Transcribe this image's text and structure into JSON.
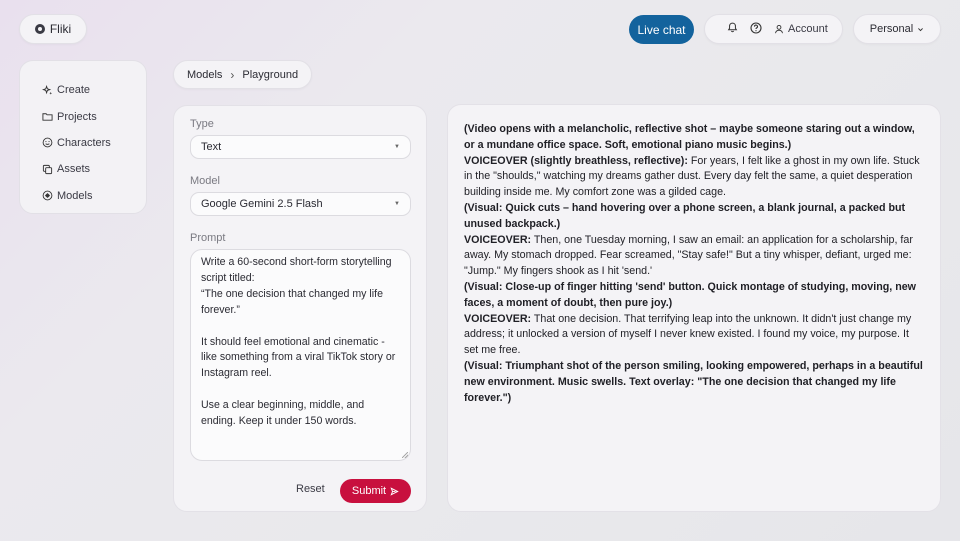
{
  "brand": {
    "name": "Fliki",
    "icon": "fliki-logo-icon"
  },
  "header": {
    "live_chat": "Live chat",
    "account": "Account",
    "workspace": "Personal",
    "icons": [
      "bell-icon",
      "help-icon",
      "user-icon",
      "chevron-down-icon"
    ]
  },
  "sidebar": {
    "items": [
      {
        "label": "Create",
        "icon": "sparkle-icon"
      },
      {
        "label": "Projects",
        "icon": "folder-icon"
      },
      {
        "label": "Characters",
        "icon": "smiley-icon"
      },
      {
        "label": "Assets",
        "icon": "copy-icon"
      },
      {
        "label": "Models",
        "icon": "grid-icon"
      }
    ]
  },
  "breadcrumb": {
    "root": "Models",
    "separator": "›",
    "current": "Playground"
  },
  "form": {
    "type_label": "Type",
    "type_value": "Text",
    "model_label": "Model",
    "model_value": "Google Gemini 2.5 Flash",
    "prompt_label": "Prompt",
    "prompt_value": "Write a 60-second short-form storytelling script titled:\n“The one decision that changed my life forever.”\n\nIt should feel emotional and cinematic - like something from a viral TikTok story or Instagram reel.\n\nUse a clear beginning, middle, and ending. Keep it under 150 words.",
    "reset_label": "Reset",
    "submit_label": "Submit"
  },
  "output": {
    "p1": "(Video opens with a melancholic, reflective shot – maybe someone staring out a window, or a mundane office space. Soft, emotional piano music begins.)",
    "p2_bold": "VOICEOVER (slightly breathless, reflective):",
    "p2_text": " For years, I felt like a ghost in my own life. Stuck in the \"shoulds,\" watching my dreams gather dust. Every day felt the same, a quiet desperation building inside me. My comfort zone was a gilded cage.",
    "p3": "(Visual: Quick cuts – hand hovering over a phone screen, a blank journal, a packed but unused backpack.)",
    "p4_bold": "VOICEOVER:",
    "p4_text": " Then, one Tuesday morning, I saw an email: an application for a scholarship, far away. My stomach dropped. Fear screamed, \"Stay safe!\" But a tiny whisper, defiant, urged me: \"Jump.\" My fingers shook as I hit 'send.'",
    "p5": "(Visual: Close-up of finger hitting 'send' button. Quick montage of studying, moving, new faces, a moment of doubt, then pure joy.)",
    "p6_bold": "VOICEOVER:",
    "p6_text": " That one decision. That terrifying leap into the unknown. It didn't just change my address; it unlocked a version of myself I never knew existed. I found my voice, my purpose. It set me free.",
    "p7": "(Visual: Triumphant shot of the person smiling, looking empowered, perhaps in a beautiful new environment. Music swells. Text overlay: \"The one decision that changed my life forever.\")"
  },
  "colors": {
    "accent_blue": "#13639d",
    "submit_red": "#c8103e"
  }
}
